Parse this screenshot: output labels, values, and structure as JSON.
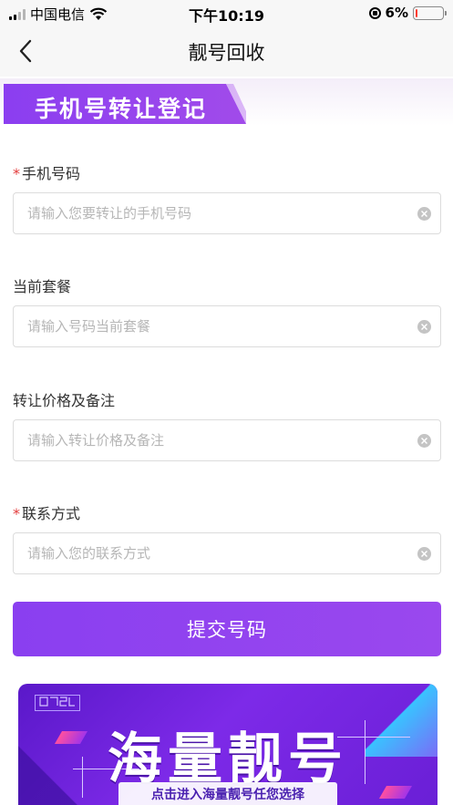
{
  "status_bar": {
    "carrier": "中国电信",
    "time": "下午10:19",
    "battery": "6%",
    "battery_level": 0.06,
    "battery_color": "#ff3b30"
  },
  "nav": {
    "title": "靓号回收",
    "back_icon": "chevron-left-icon"
  },
  "banner": {
    "title": "手机号转让登记"
  },
  "form": {
    "required_mark": "*",
    "fields": [
      {
        "label": "手机号码",
        "required": true,
        "placeholder": "请输入您要转让的手机号码",
        "value": ""
      },
      {
        "label": "当前套餐",
        "required": false,
        "placeholder": "请输入号码当前套餐",
        "value": ""
      },
      {
        "label": "转让价格及备注",
        "required": false,
        "placeholder": "请输入转让价格及备注",
        "value": ""
      },
      {
        "label": "联系方式",
        "required": true,
        "placeholder": "请输入您的联系方式",
        "value": ""
      }
    ],
    "submit_label": "提交号码"
  },
  "promo": {
    "title": "海量靓号",
    "subtitle": "点击进入海量靓号任您选择"
  },
  "colors": {
    "accent": "#8a3ff0",
    "required": "#e33b3b"
  }
}
